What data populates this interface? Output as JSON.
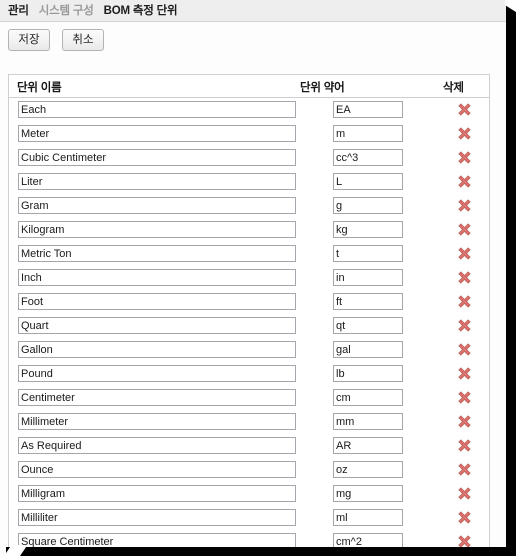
{
  "breadcrumb": {
    "items": [
      {
        "label": "관리",
        "state": "active"
      },
      {
        "label": "시스템 구성",
        "state": "muted"
      },
      {
        "label": "BOM 측정 단위",
        "state": "active"
      }
    ]
  },
  "toolbar": {
    "save_label": "저장",
    "cancel_label": "취소"
  },
  "table": {
    "columns": {
      "name": "단위 이름",
      "abbreviation": "단위 약어",
      "delete": "삭제"
    },
    "delete_icon": "x-mark-icon",
    "rows": [
      {
        "name": "Each",
        "abbr": "EA"
      },
      {
        "name": "Meter",
        "abbr": "m"
      },
      {
        "name": "Cubic Centimeter",
        "abbr": "cc^3"
      },
      {
        "name": "Liter",
        "abbr": "L"
      },
      {
        "name": "Gram",
        "abbr": "g"
      },
      {
        "name": "Kilogram",
        "abbr": "kg"
      },
      {
        "name": "Metric Ton",
        "abbr": "t"
      },
      {
        "name": "Inch",
        "abbr": "in"
      },
      {
        "name": "Foot",
        "abbr": "ft"
      },
      {
        "name": "Quart",
        "abbr": "qt"
      },
      {
        "name": "Gallon",
        "abbr": "gal"
      },
      {
        "name": "Pound",
        "abbr": "lb"
      },
      {
        "name": "Centimeter",
        "abbr": "cm"
      },
      {
        "name": "Millimeter",
        "abbr": "mm"
      },
      {
        "name": "As Required",
        "abbr": "AR"
      },
      {
        "name": "Ounce",
        "abbr": "oz"
      },
      {
        "name": "Milligram",
        "abbr": "mg"
      },
      {
        "name": "Milliliter",
        "abbr": "ml"
      },
      {
        "name": "Square Centimeter",
        "abbr": "cm^2"
      }
    ]
  },
  "colors": {
    "delete_icon": "#d9736f",
    "delete_icon_outline": "#b95b57",
    "header_bg": "#eeeeee",
    "panel_border": "#cfcfcf",
    "shadow": "#000000"
  }
}
